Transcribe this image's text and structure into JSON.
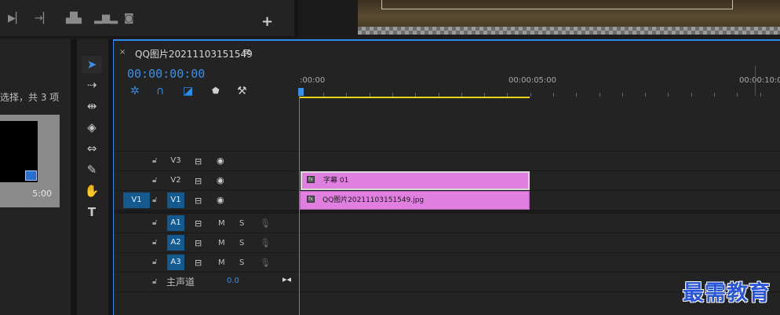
{
  "project_panel": {
    "selection_text": "选择，共 3 项",
    "thumbnail_duration": "5:00"
  },
  "sequence_tab": {
    "close_label": "×",
    "title": "QQ图片20211103151549",
    "menu_label": "≡",
    "timecode": "00:00:00:00"
  },
  "ruler": {
    "labels": [
      ":00:00",
      "00:00:05:00",
      "00:00:10:00"
    ]
  },
  "tracks": {
    "video": [
      {
        "name": "V3",
        "source": ""
      },
      {
        "name": "V2",
        "source": ""
      },
      {
        "name": "V1",
        "source": "V1"
      }
    ],
    "audio": [
      {
        "name": "A1",
        "m": "M",
        "s": "S"
      },
      {
        "name": "A2",
        "m": "M",
        "s": "S"
      },
      {
        "name": "A3",
        "m": "M",
        "s": "S"
      }
    ],
    "master": {
      "label": "主声道",
      "value": "0.0"
    }
  },
  "clips": {
    "title_clip": "字幕 01",
    "image_clip": "QQ图片20211103151549.jpg",
    "color": "#e07fe0"
  },
  "colors": {
    "accent": "#2d8ceb",
    "work_area": "#e8d21a",
    "track_target": "#155a8f"
  },
  "icons": {
    "top_toolbar": [
      "step-forward-icon",
      "insert-icon",
      "lift-icon",
      "extract-icon",
      "camera-icon",
      "add-icon"
    ],
    "tools": [
      "selection-arrow-icon",
      "track-select-icon",
      "ripple-edit-icon",
      "razor-icon",
      "slip-icon",
      "pen-icon",
      "hand-icon",
      "type-icon"
    ],
    "timeline_tools": [
      "nest-icon",
      "snap-icon",
      "linked-selection-icon",
      "add-marker-icon",
      "wrench-icon"
    ]
  },
  "watermark": "最需教育"
}
